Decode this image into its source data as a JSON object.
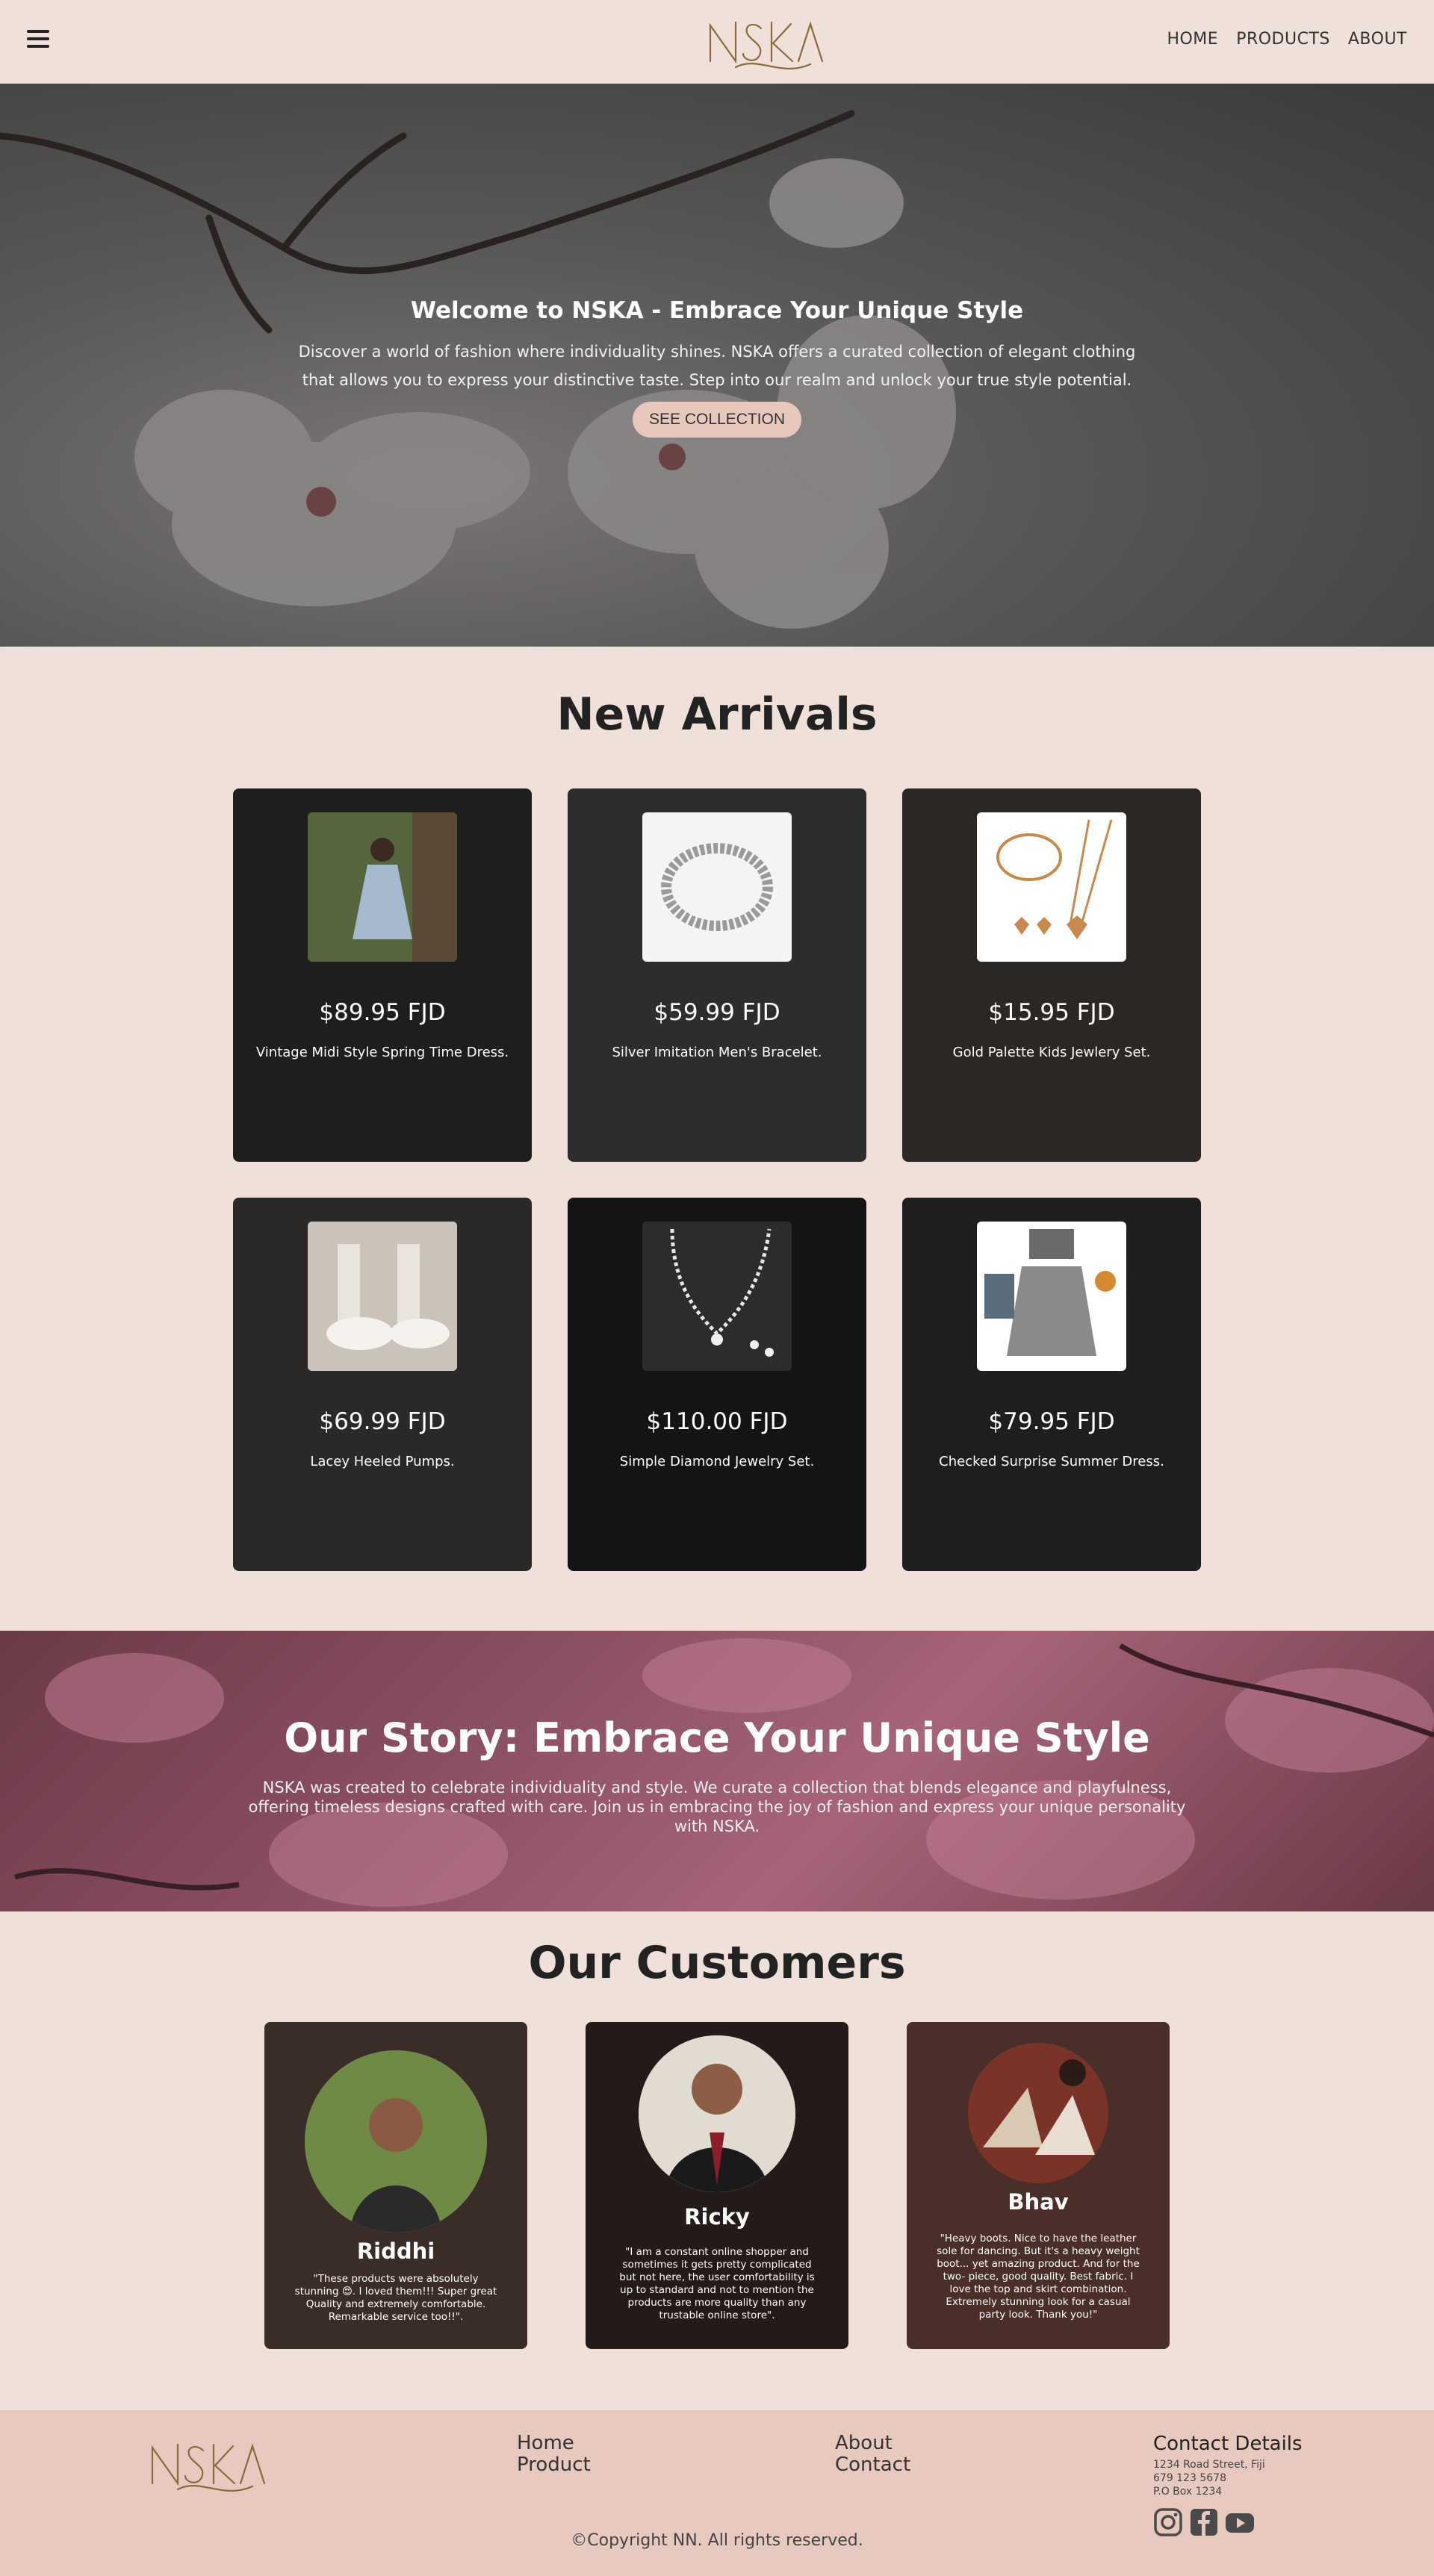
{
  "brand": {
    "name": "NSKA",
    "accent": "#e8c7bd",
    "background": "#f0e0da"
  },
  "nav": {
    "menu_icon": "hamburger-icon",
    "links": [
      "HOME",
      "PRODUCTS",
      "ABOUT"
    ]
  },
  "hero": {
    "title": "Welcome to NSKA - Embrace Your Unique Style",
    "text": "Discover a world of fashion where individuality shines. NSKA offers a curated collection of elegant clothing that allows you to express your distinctive taste. Step into our realm and unlock your true style potential.",
    "button": "SEE COLLECTION"
  },
  "arrivals": {
    "title": "New Arrivals",
    "products": [
      {
        "price": "$89.95 FJD",
        "name": "Vintage Midi Style Spring Time Dress."
      },
      {
        "price": "$59.99 FJD",
        "name": "Silver Imitation Men's Bracelet."
      },
      {
        "price": "$15.95 FJD",
        "name": "Gold Palette Kids Jewlery Set."
      },
      {
        "price": "$69.99 FJD",
        "name": "Lacey Heeled Pumps."
      },
      {
        "price": "$110.00 FJD",
        "name": "Simple Diamond Jewelry Set."
      },
      {
        "price": "$79.95 FJD",
        "name": "Checked Surprise Summer Dress."
      }
    ]
  },
  "story": {
    "title": "Our Story: Embrace Your Unique Style",
    "text": "NSKA was created to celebrate individuality and style. We curate a collection that blends elegance and playfulness, offering timeless designs crafted with care. Join us in embracing the joy of fashion and express your unique personality with NSKA."
  },
  "customers": {
    "title": "Our Customers",
    "items": [
      {
        "name": "Riddhi",
        "quote": "\"These products were absolutely stunning 😍. I loved them!!! Super great Quality and extremely comfortable. Remarkable service too!!\"."
      },
      {
        "name": "Ricky",
        "quote": "\"I am a constant online shopper and sometimes it gets pretty complicated but not here, the user comfortability is up to standard and not to mention the products are more quality than any trustable online store\"."
      },
      {
        "name": "Bhav",
        "quote": "\"Heavy boots. Nice to have the leather sole for dancing. But it's a heavy weight boot... yet amazing product. And for the two- piece, good quality. Best fabric. I love the top and skirt combination. Extremely stunning look for a casual party look. Thank you!\""
      }
    ]
  },
  "footer": {
    "col1": [
      "Home",
      "Product"
    ],
    "col2": [
      "About",
      "Contact"
    ],
    "contact_title": "Contact Details",
    "contact_lines": [
      "1234 Road Street, Fiji",
      "679 123 5678",
      "P.O Box 1234"
    ],
    "social_icons": [
      "instagram-icon",
      "facebook-icon",
      "youtube-icon"
    ],
    "copyright": "©Copyright NN. All rights reserved."
  }
}
